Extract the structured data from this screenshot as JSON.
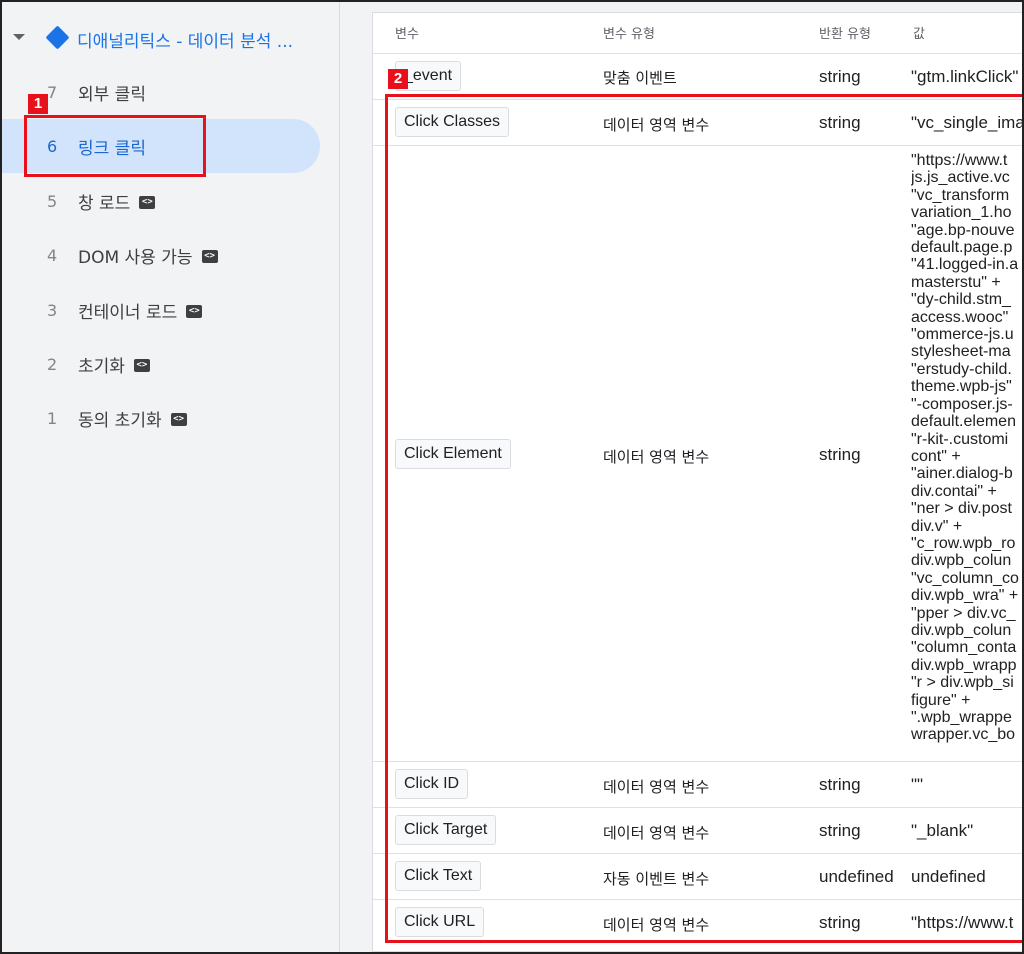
{
  "sidebar": {
    "container_title": "디애널리틱스 - 데이터 분석 ...",
    "events": [
      {
        "num": "7",
        "label": "외부 클릭",
        "has_code_icon": false
      },
      {
        "num": "6",
        "label": "링크 클릭",
        "has_code_icon": false,
        "selected": true
      },
      {
        "num": "5",
        "label": "창 로드",
        "has_code_icon": true
      },
      {
        "num": "4",
        "label": "DOM 사용 가능",
        "has_code_icon": true
      },
      {
        "num": "3",
        "label": "컨테이너 로드",
        "has_code_icon": true
      },
      {
        "num": "2",
        "label": "초기화",
        "has_code_icon": true
      },
      {
        "num": "1",
        "label": "동의 초기화",
        "has_code_icon": true
      }
    ],
    "code_icon_glyph": "<>"
  },
  "table": {
    "headers": {
      "variable": "변수",
      "variable_type": "변수 유형",
      "return_type": "반환 유형",
      "value": "값"
    },
    "rows": [
      {
        "variable": "_event",
        "type": "맞춤 이벤트",
        "return_type": "string",
        "value": "\"gtm.linkClick\""
      },
      {
        "variable": "Click Classes",
        "type": "데이터 영역 변수",
        "return_type": "string",
        "value": "\"vc_single_ima"
      },
      {
        "variable": "Click Element",
        "type": "데이터 영역 변수",
        "return_type": "string",
        "value": "\"https://www.t\njs.js_active.vc\n\"vc_transform\nvariation_1.ho\n\"age.bp-nouve\ndefault.page.p\n\"41.logged-in.a\nmasterstu\" +\n\"dy-child.stm_\naccess.wooc\"\n\"ommerce-js.u\nstylesheet-ma\n\"erstudy-child.\ntheme.wpb-js\"\n\"-composer.js-\ndefault.elemen\n\"r-kit-.customi\ncont\" +\n\"ainer.dialog-b\ndiv.contai\" +\n\"ner > div.post\ndiv.v\" +\n\"c_row.wpb_ro\ndiv.wpb_colun\n\"vc_column_co\ndiv.wpb_wra\" +\n\"pper > div.vc_\ndiv.wpb_colun\n\"column_conta\ndiv.wpb_wrapp\n\"r > div.wpb_si\nfigure\" +\n\".wpb_wrappe\nwrapper.vc_bo"
      },
      {
        "variable": "Click ID",
        "type": "데이터 영역 변수",
        "return_type": "string",
        "value": "\"\""
      },
      {
        "variable": "Click Target",
        "type": "데이터 영역 변수",
        "return_type": "string",
        "value": "\"_blank\""
      },
      {
        "variable": "Click Text",
        "type": "자동 이벤트 변수",
        "return_type": "undefined",
        "value": "undefined"
      },
      {
        "variable": "Click URL",
        "type": "데이터 영역 변수",
        "return_type": "string",
        "value": "\"https://www.t"
      }
    ]
  },
  "annotations": [
    {
      "label": "1",
      "color": "#e8101a"
    },
    {
      "label": "2",
      "color": "#e8101a"
    }
  ]
}
